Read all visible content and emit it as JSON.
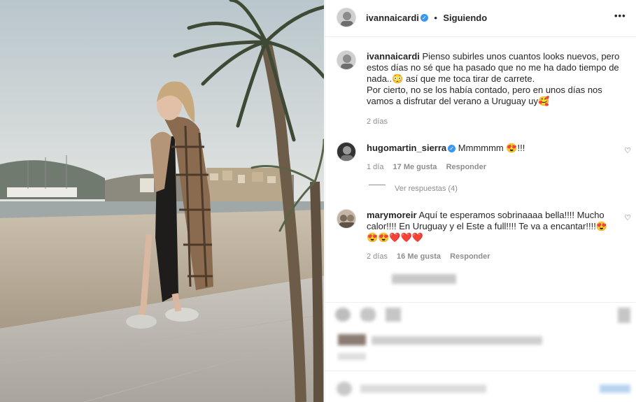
{
  "header": {
    "username": "ivannaicardi",
    "verified_mark": "✓",
    "separator": "•",
    "follow_status": "Siguiendo",
    "more_icon": "•••"
  },
  "caption": {
    "username": "ivannaicardi",
    "text": "Pienso subirles unos cuantos looks nuevos, pero estos días no sé que ha pasado que no me ha dado tiempo de nada..😳 así que me toca tirar de carrete.\nPor cierto, no se los había contado, pero en unos días nos vamos a disfrutar del verano a Uruguay uy🥰",
    "time": "2 días"
  },
  "comments": [
    {
      "username": "hugomartin_sierra",
      "text": "Mmmmmm 😍!!!",
      "time": "1 día",
      "likes": "17 Me gusta",
      "reply": "Responder",
      "view_replies": "Ver respuestas (4)"
    },
    {
      "username": "marymoreir",
      "text": "Aquí te esperamos sobrinaaaa bella!!!! Mucho calor!!!! En Uruguay y el Este a full!!!! Te va a encantar!!!!😍😍😍❤️❤️❤️",
      "time": "2 días",
      "likes": "16 Me gusta",
      "reply": "Responder"
    }
  ],
  "colors": {
    "verified": "#3897f0",
    "muted": "#8e8e8e",
    "border": "#efefef"
  }
}
